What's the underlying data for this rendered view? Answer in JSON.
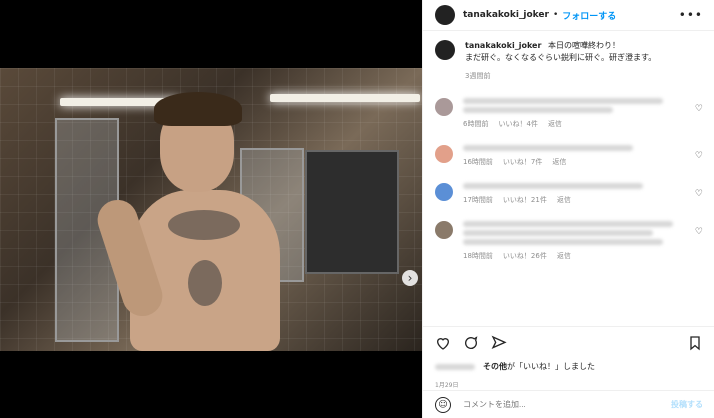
{
  "header": {
    "username": "tanakakoki_joker",
    "separator": "•",
    "follow_label": "フォローする",
    "more_label": "•••"
  },
  "caption": {
    "username": "tanakakoki_joker",
    "line1": "本日の喧嘩終わり！",
    "line2": "まだ研ぐ。なくなるぐらい鋭利に研ぐ。研ぎ澄ます。",
    "time": "3週間前"
  },
  "comments": [
    {
      "time": "6時間前",
      "likes": "いいね！4件",
      "reply": "返信"
    },
    {
      "time": "16時間前",
      "likes": "いいね！7件",
      "reply": "返信"
    },
    {
      "time": "17時間前",
      "likes": "いいね！21件",
      "reply": "返信"
    },
    {
      "time": "18時間前",
      "likes": "いいね！26件",
      "reply": "返信"
    }
  ],
  "likes_text": "その他が「いいね！」しました",
  "likes_bold": "その他",
  "post_date": "1月29日",
  "composer": {
    "placeholder": "コメントを追加...",
    "post_label": "投稿する"
  },
  "colors": {
    "accent": "#0095f6",
    "text": "#262626",
    "muted": "#8e8e8e"
  },
  "carousel": {
    "current": 1,
    "total": 2
  }
}
